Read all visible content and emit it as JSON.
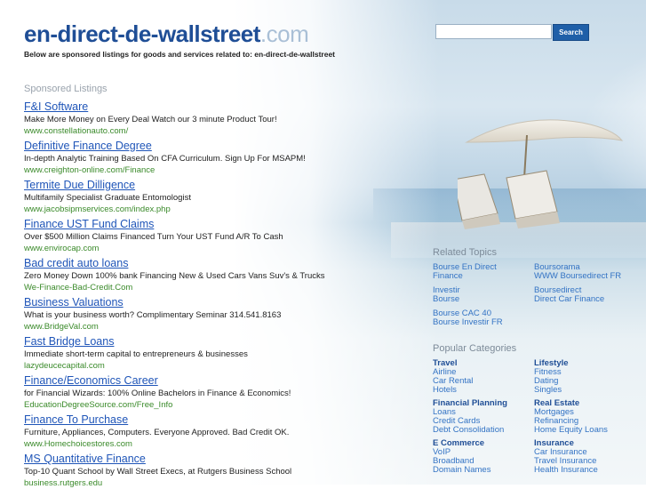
{
  "header": {
    "domain_name": "en-direct-de-wallstreet",
    "domain_tld": ".com",
    "subline": "Below are sponsored listings for goods and services related to: en-direct-de-wallstreet"
  },
  "search": {
    "value": "",
    "button_label": "Search"
  },
  "sponsored": {
    "heading": "Sponsored Listings",
    "listings": [
      {
        "title": "F&I Software",
        "desc": "Make More Money on Every Deal Watch our 3 minute Product Tour!",
        "url": "www.constellationauto.com/"
      },
      {
        "title": "Definitive Finance Degree",
        "desc": "In-depth Analytic Training Based On CFA Curriculum. Sign Up For MSAPM!",
        "url": "www.creighton-online.com/Finance"
      },
      {
        "title": "Termite Due Dilligence",
        "desc": "Multifamily Specialist Graduate Entomologist",
        "url": "www.jacobsipmservices.com/index.php"
      },
      {
        "title": "Finance UST Fund Claims",
        "desc": "Over $500 Million Claims Financed Turn Your UST Fund A/R To Cash",
        "url": "www.envirocap.com"
      },
      {
        "title": "Bad credit auto loans",
        "desc": "Zero Money Down 100% bank Financing New & Used Cars Vans Suv's & Trucks",
        "url": "We-Finance-Bad-Credit.Com"
      },
      {
        "title": "Business Valuations",
        "desc": "What is your business worth? Complimentary Seminar 314.541.8163",
        "url": "www.BridgeVal.com"
      },
      {
        "title": "Fast Bridge Loans",
        "desc": "Immediate short-term capital to entrepreneurs & businesses",
        "url": "lazydeucecapital.com"
      },
      {
        "title": "Finance/Economics Career",
        "desc": "for Financial Wizards: 100% Online Bachelors in Finance & Economics!",
        "url": "EducationDegreeSource.com/Free_Info"
      },
      {
        "title": "Finance To Purchase",
        "desc": "Furniture, Appliances, Computers. Everyone Approved. Bad Credit OK.",
        "url": "www.Homechoicestores.com"
      },
      {
        "title": "MS Quantitative Finance",
        "desc": "Top-10 Quant School by Wall Street Execs, at Rutgers Business School",
        "url": "business.rutgers.edu"
      }
    ]
  },
  "related": {
    "heading": "Related Topics",
    "links": [
      [
        "Bourse En Direct",
        "Finance"
      ],
      [
        "Boursorama",
        "WWW Boursedirect FR"
      ],
      [
        "Investir",
        "Bourse"
      ],
      [
        "Boursedirect",
        "Direct Car Finance"
      ],
      [
        "Bourse CAC 40",
        "Bourse Investir FR"
      ]
    ]
  },
  "popular": {
    "heading": "Popular Categories",
    "groups": [
      {
        "title": "Travel",
        "items": [
          "Airline",
          "Car Rental",
          "Hotels"
        ]
      },
      {
        "title": "Lifestyle",
        "items": [
          "Fitness",
          "Dating",
          "Singles"
        ]
      },
      {
        "title": "Financial Planning",
        "items": [
          "Loans",
          "Credit Cards",
          "Debt Consolidation"
        ]
      },
      {
        "title": "Real Estate",
        "items": [
          "Mortgages",
          "Refinancing",
          "Home Equity Loans"
        ]
      },
      {
        "title": "E Commerce",
        "items": [
          "VoIP",
          "Broadband",
          "Domain Names"
        ]
      },
      {
        "title": "Insurance",
        "items": [
          "Car Insurance",
          "Travel Insurance",
          "Health Insurance"
        ]
      }
    ]
  },
  "colors": {
    "domain_name": "#1f4e96",
    "domain_tld": "#a9bfd6",
    "link": "#1f55b8",
    "url": "#3a8a2a",
    "button": "#1f5fa8"
  }
}
